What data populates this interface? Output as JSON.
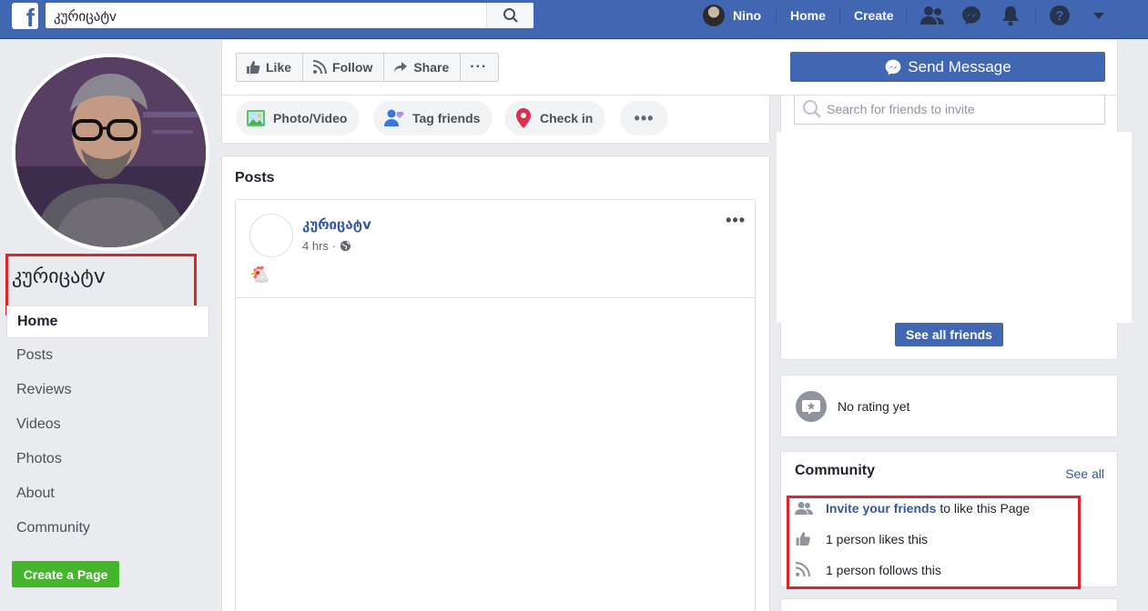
{
  "topbar": {
    "search_value": "კურიცატv",
    "user_name": "Nino",
    "home_label": "Home",
    "create_label": "Create",
    "colors": {
      "bar": "#4267b2"
    }
  },
  "page": {
    "name": "კურიცატv"
  },
  "left_nav": {
    "items": [
      {
        "label": "Home"
      },
      {
        "label": "Posts"
      },
      {
        "label": "Reviews"
      },
      {
        "label": "Videos"
      },
      {
        "label": "Photos"
      },
      {
        "label": "About"
      },
      {
        "label": "Community"
      }
    ],
    "create_page_label": "Create a Page"
  },
  "actions": {
    "like_label": "Like",
    "follow_label": "Follow",
    "share_label": "Share",
    "more_label": "···",
    "send_message_label": "Send Message"
  },
  "composer": {
    "photo_video_label": "Photo/Video",
    "tag_friends_label": "Tag friends",
    "check_in_label": "Check in"
  },
  "posts": {
    "title": "Posts",
    "items": [
      {
        "author": "კურიცატv",
        "time": "4 hrs",
        "content": "🐔"
      }
    ]
  },
  "invite": {
    "search_placeholder": "Search for friends to invite",
    "see_all_friends_label": "See all friends"
  },
  "rating": {
    "text": "No rating yet"
  },
  "community": {
    "title": "Community",
    "see_all_label": "See all",
    "invite_link": "Invite your friends",
    "invite_suffix": "to like this Page",
    "likes_text": "1 person likes this",
    "follows_text": "1 person follows this"
  }
}
